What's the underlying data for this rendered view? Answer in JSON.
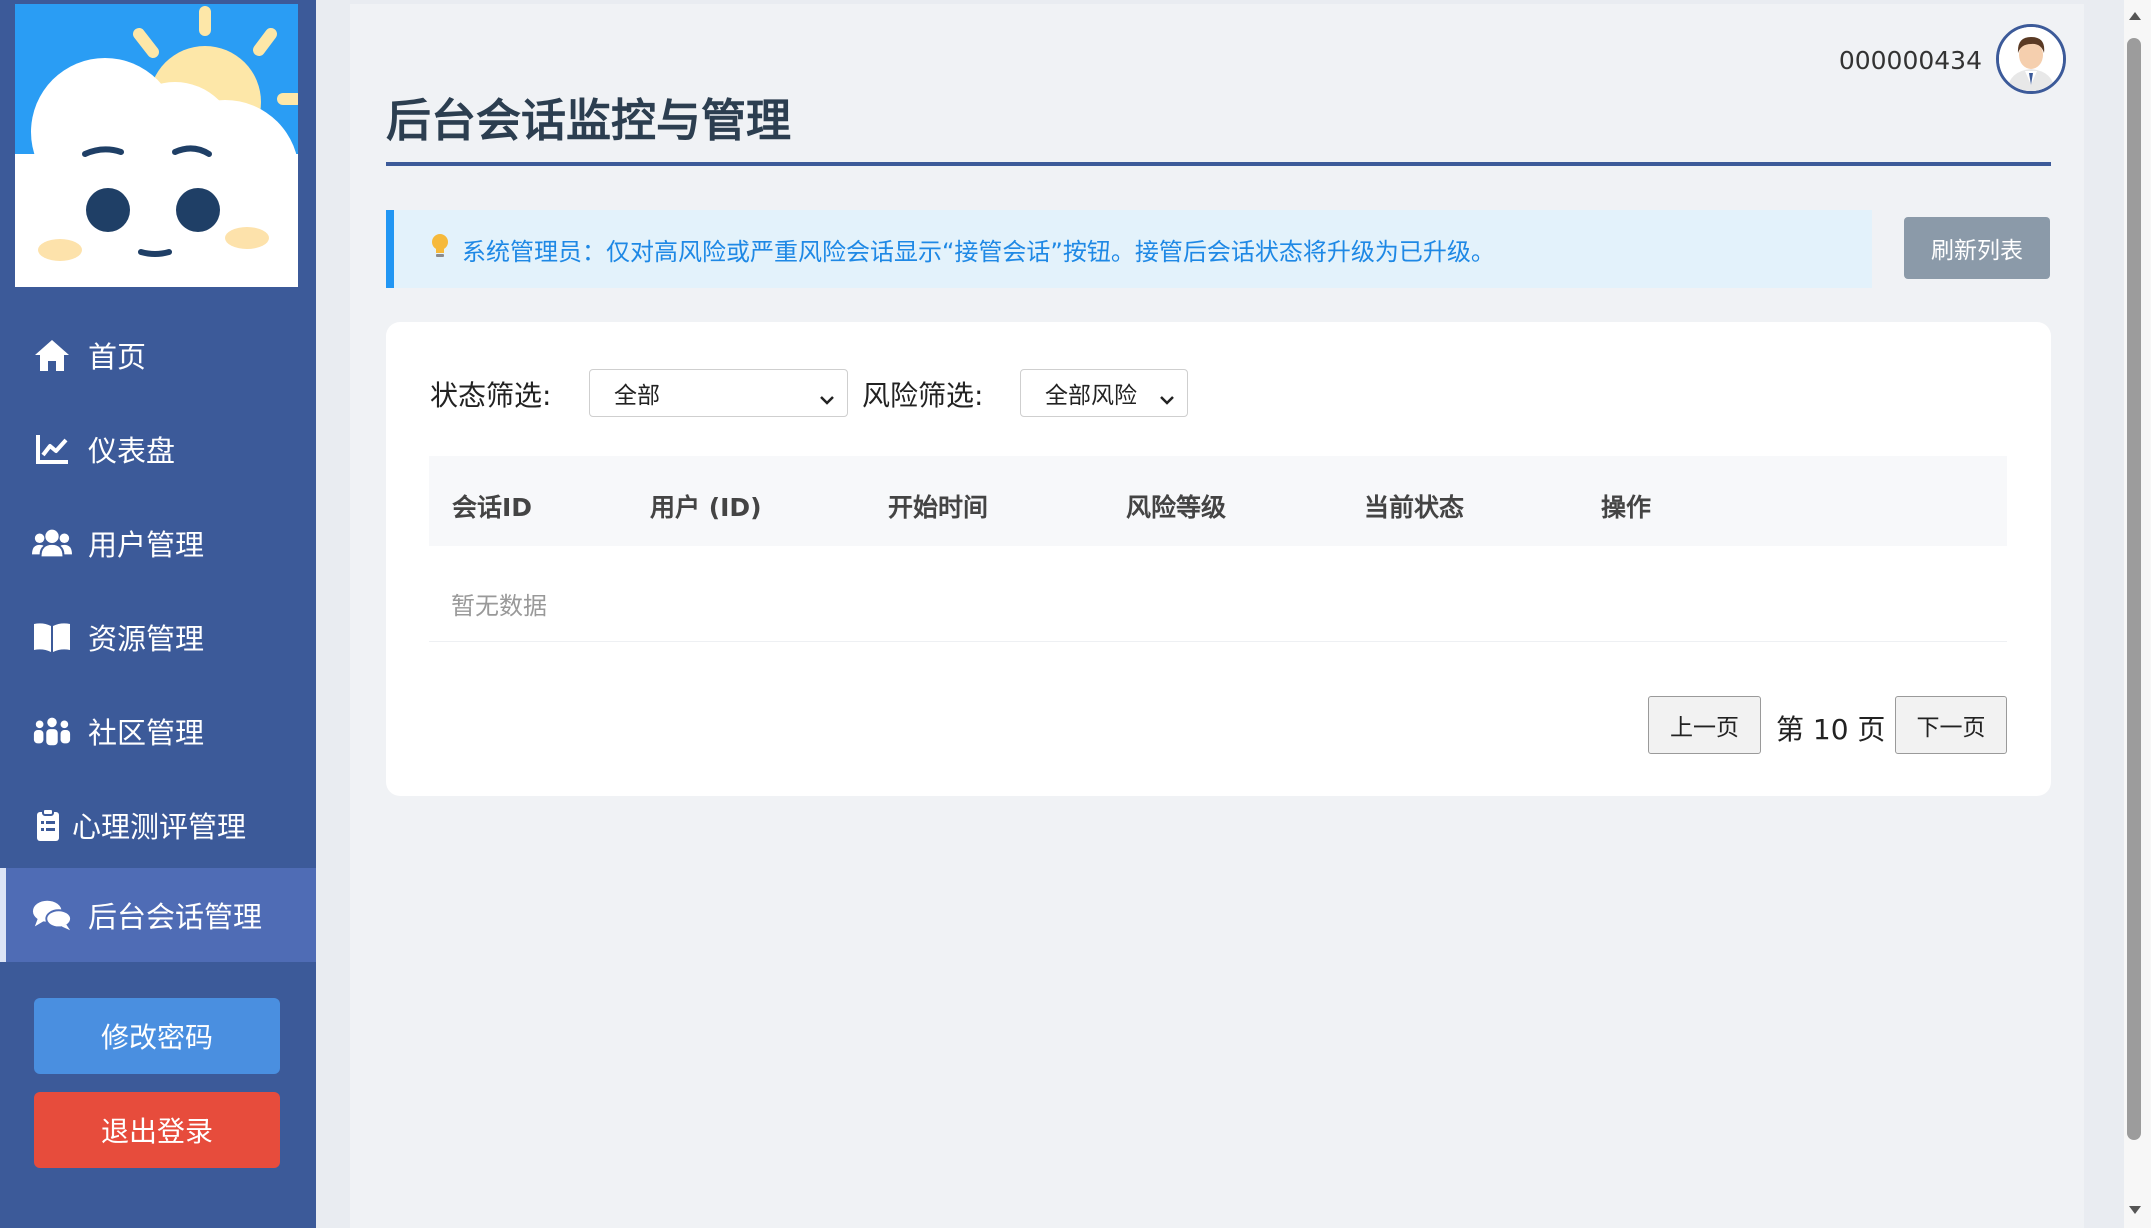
{
  "sidebar": {
    "logo_icon": "cloud-sun-mascot",
    "items": [
      {
        "label": "首页",
        "icon": "home-icon"
      },
      {
        "label": "仪表盘",
        "icon": "chart-line-icon"
      },
      {
        "label": "用户管理",
        "icon": "users-icon"
      },
      {
        "label": "资源管理",
        "icon": "book-icon"
      },
      {
        "label": "社区管理",
        "icon": "people-group-icon"
      },
      {
        "label": "心理测评管理",
        "icon": "clipboard-icon"
      },
      {
        "label": "后台会话管理",
        "icon": "comments-icon",
        "active": true
      }
    ],
    "change_password_label": "修改密码",
    "logout_label": "退出登录"
  },
  "header": {
    "user_id": "000000434",
    "avatar_icon": "user-avatar"
  },
  "page": {
    "title": "后台会话监控与管理",
    "notice_icon": "lightbulb-icon",
    "notice_text": "系统管理员：仅对高风险或严重风险会话显示“接管会话”按钮。接管后会话状态将升级为已升级。",
    "refresh_label": "刷新列表"
  },
  "filters": {
    "status_label": "状态筛选:",
    "status_value": "全部",
    "risk_label": "风险筛选:",
    "risk_value": "全部风险"
  },
  "table": {
    "columns": [
      "会话ID",
      "用户 (ID)",
      "开始时间",
      "风险等级",
      "当前状态",
      "操作"
    ],
    "empty_text": "暂无数据"
  },
  "pagination": {
    "prev_label": "上一页",
    "page_info": "第 10 页",
    "next_label": "下一页"
  },
  "colors": {
    "sidebar": "#3c5a99",
    "sidebar_active": "#4f6cb5",
    "primary_button": "#4a8fe0",
    "danger_button": "#e74c3c",
    "notice_bg": "#e3f2fb",
    "notice_accent": "#2196f3",
    "refresh_button": "#8b9aa9"
  }
}
